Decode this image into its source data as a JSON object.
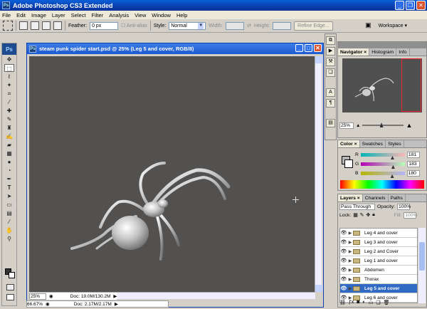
{
  "app": {
    "title": "Adobe Photoshop CS3 Extended",
    "icon_label": "Ps"
  },
  "menu": [
    "File",
    "Edit",
    "Image",
    "Layer",
    "Select",
    "Filter",
    "Analysis",
    "View",
    "Window",
    "Help"
  ],
  "options": {
    "feather_label": "Feather:",
    "feather_value": "0 px",
    "antialias_label": "Anti-alias",
    "style_label": "Style:",
    "style_value": "Normal",
    "width_label": "Width:",
    "height_label": "Height:",
    "refine_edge": "Refine Edge...",
    "workspace_label": "Workspace ▾"
  },
  "document": {
    "title": "steam punk spider start.psd @ 25% (Leg 5 and cover, RGB/8)",
    "zoom": "25%",
    "doc_size": "Doc: 19.0M/130.2M"
  },
  "second_document": {
    "zoom": "66.67%",
    "doc_size": "Doc: 2.17M/2.17M"
  },
  "navigator": {
    "tabs": [
      "Navigator",
      "Histogram",
      "Info"
    ],
    "zoom": "25%",
    "zoom_fraction": 0.45
  },
  "color_panel": {
    "tabs": [
      "Color",
      "Swatches",
      "Styles"
    ],
    "channels": [
      {
        "label": "R",
        "value": "181",
        "fraction": 0.71,
        "gradient": "linear-gradient(to right,#00b5b5,#ffb5b5)"
      },
      {
        "label": "G",
        "value": "183",
        "fraction": 0.72,
        "gradient": "linear-gradient(to right,#b500b5,#b5ffb5)"
      },
      {
        "label": "B",
        "value": "180",
        "fraction": 0.71,
        "gradient": "linear-gradient(to right,#b5b500,#b5b5ff)"
      }
    ]
  },
  "layers_panel": {
    "tabs": [
      "Layers",
      "Channels",
      "Paths"
    ],
    "blend_mode": "Pass Through",
    "opacity_label": "Opacity:",
    "opacity_value": "100%",
    "lock_label": "Lock:",
    "fill_label": "Fill:",
    "fill_value": "100%",
    "layers": [
      {
        "name": "Leg 4 and cover",
        "active": false
      },
      {
        "name": "Leg 3 and cover",
        "active": false
      },
      {
        "name": "Leg 2 and Cover",
        "active": false
      },
      {
        "name": "Leg 1 and cover",
        "active": false
      },
      {
        "name": "Abdomen",
        "active": false
      },
      {
        "name": "Thorax",
        "active": false
      },
      {
        "name": "Leg 5 and cover",
        "active": true
      },
      {
        "name": "Leg 6 and cover",
        "active": false
      }
    ]
  },
  "colors": {
    "canvas_bg": "#525150",
    "titlebar": "#0a3fb0",
    "selection": "#316ac5"
  }
}
